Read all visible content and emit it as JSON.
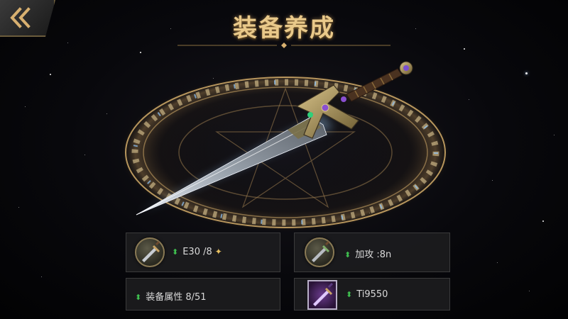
{
  "header": {
    "title": "装备养成"
  },
  "icons": {
    "back": "double-chevron-left-icon",
    "up_arrow": "green-up-arrow-icon"
  },
  "stats": [
    {
      "icon": "sword-icon",
      "value": "E30 /8",
      "has_plus": true
    },
    {
      "icon": "sword-icon",
      "value": "加攻 :8n",
      "has_plus": false
    },
    {
      "icon": "none",
      "value": "装备属性 8/51",
      "has_plus": false
    },
    {
      "icon": "purple-sword-icon",
      "value": "Ti9550",
      "has_plus": false
    }
  ],
  "colors": {
    "title_gold": "#e9c98a",
    "rune_glow": "#d8b070",
    "up_green": "#3fbf4f",
    "gem_purple": "#8a4fd0",
    "gem_green": "#2fd07a"
  }
}
